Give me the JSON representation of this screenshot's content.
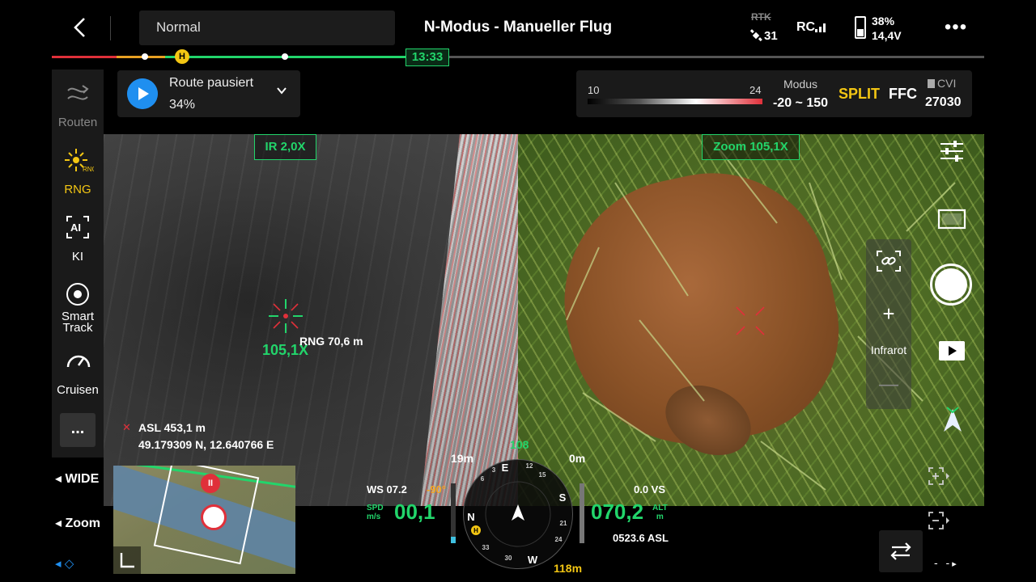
{
  "header": {
    "mode_value": "Normal",
    "flight_mode_title": "N-Modus - Manueller Flug",
    "rtk_label": "RTK",
    "satellite_count": "31",
    "rc_label": "RC",
    "battery_percent": "38%",
    "battery_voltage": "14,4V",
    "more_label": "•••"
  },
  "timeline": {
    "home_marker": "H",
    "time_remaining": "13:33"
  },
  "tools": {
    "routes": "Routen",
    "rng": "RNG",
    "ai": "KI",
    "smart_track_1": "Smart",
    "smart_track_2": "Track",
    "cruise": "Cruisen",
    "more": "..."
  },
  "route_status": {
    "title": "Route pausiert",
    "percent": "34%"
  },
  "thermal": {
    "temp_min": "10",
    "temp_max": "24",
    "modus_label": "Modus",
    "modus_range": "-20 ~ 150",
    "split_label": "SPLIT",
    "ffc_label": "FFC",
    "cvi_label": "CVI",
    "cvi_value": "27030"
  },
  "ir_view": {
    "tag": "IR  2,0X",
    "zoom_readout": "105,1X",
    "rng_readout": "RNG 70,6 m"
  },
  "zoom_view": {
    "tag": "Zoom  105,1X"
  },
  "location": {
    "asl": "ASL 453,1 m",
    "coords": "49.179309 N, 12.640766 E"
  },
  "camera_controls": {
    "infrarot_label": "Infrarot",
    "plus": "+",
    "minus": "—",
    "lens_label": "- -"
  },
  "lens_buttons": {
    "wide": "◂ WIDE",
    "zoom": "◂ Zoom",
    "layer": "◂ ◇"
  },
  "minimap": {
    "pause_label": "II"
  },
  "hud": {
    "wind_speed": "WS 07.2",
    "gimbal_pitch": "-90°",
    "speed_label_1": "SPD",
    "speed_label_2": "m/s",
    "speed_value": "00,1",
    "altitude_value": "070,2",
    "alt_label_1": "ALT",
    "alt_label_2": "m",
    "vertical_speed": "0.0  VS",
    "asl_value": "0523.6 ASL",
    "dist_left": "19m",
    "dist_right": "0m",
    "dist_top": "108",
    "dist_home": "118m"
  },
  "compass": {
    "north": "N",
    "east": "E",
    "south": "S",
    "west": "W",
    "tick_3": "3",
    "tick_6": "6",
    "tick_12": "12",
    "tick_15": "15",
    "tick_21": "21",
    "tick_24": "24",
    "tick_30": "30",
    "tick_33": "33",
    "home": "H"
  },
  "colors": {
    "accent_green": "#22d56b",
    "accent_yellow": "#f3c613",
    "accent_blue": "#1f8ff0",
    "alert_red": "#e0303a"
  }
}
